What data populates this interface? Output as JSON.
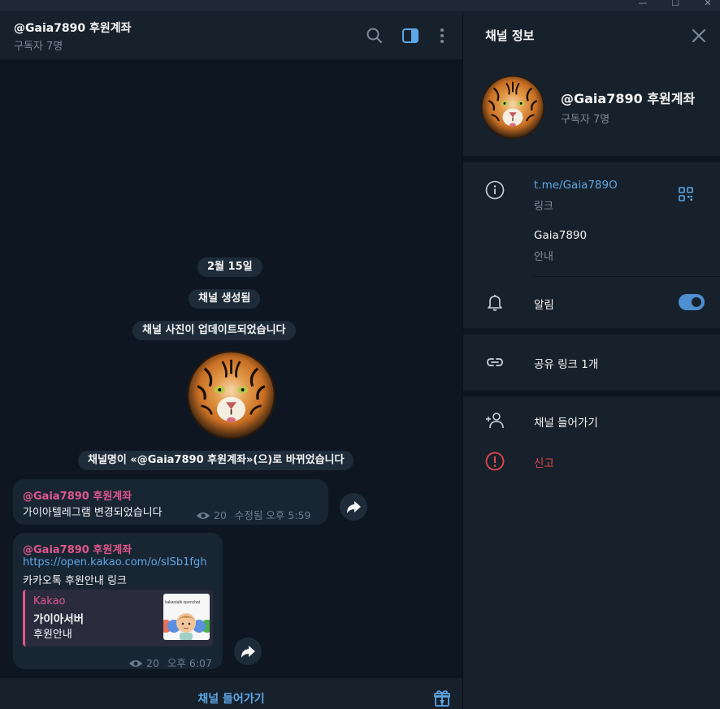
{
  "window": {
    "controls": [
      "—",
      "☐",
      "✕"
    ]
  },
  "header": {
    "title": "@Gaia7890 후원계좌",
    "subtitle": "구독자 7명"
  },
  "service": {
    "date": "2월 15일",
    "created": "채널 생성됨",
    "photo_updated": "채널 사진이 업데이트되었습니다",
    "renamed": "채널명이 «@Gaia7890 후원계좌»(으)로 바뀌었습니다"
  },
  "messages": [
    {
      "author": "@Gaia7890 후원계좌",
      "text": "가이아텔레그램 변경되었습니다",
      "views": "20",
      "edited": "수정됨",
      "time": "오후 5:59"
    },
    {
      "author": "@Gaia7890 후원계좌",
      "link": "https://open.kakao.com/o/sISb1fgh",
      "text": "카카오톡 후원안내 링크",
      "preview": {
        "site": "Kakao",
        "title": "가이아서버",
        "description": "후원안내",
        "thumb_text": "kakaotalk openchat"
      },
      "views": "20",
      "time": "오후 6:07"
    }
  ],
  "footer": {
    "join_label": "채널 들어가기"
  },
  "info_panel": {
    "title": "채널 정보",
    "name": "@Gaia7890 후원계좌",
    "subscribers": "구독자 7명",
    "link": "t.me/Gaia789O",
    "link_caption": "링크",
    "about": "Gaia7890",
    "about_caption": "안내",
    "notifications_label": "알림",
    "notifications_on": true,
    "share_links": "공유 링크 1개",
    "join": "채널 들어가기",
    "report": "신고"
  },
  "colors": {
    "accent": "#5ea7e6",
    "author": "#e0578b",
    "danger": "#e5484d",
    "bg": "#0e1621",
    "panel": "#17212b",
    "bubble": "#182533"
  },
  "icons": [
    "search-icon",
    "sidebar-toggle-icon",
    "more-vertical-icon",
    "close-icon",
    "info-icon",
    "qr-code-icon",
    "bell-icon",
    "link-icon",
    "add-user-icon",
    "report-icon",
    "eye-icon",
    "forward-icon",
    "gift-icon"
  ]
}
